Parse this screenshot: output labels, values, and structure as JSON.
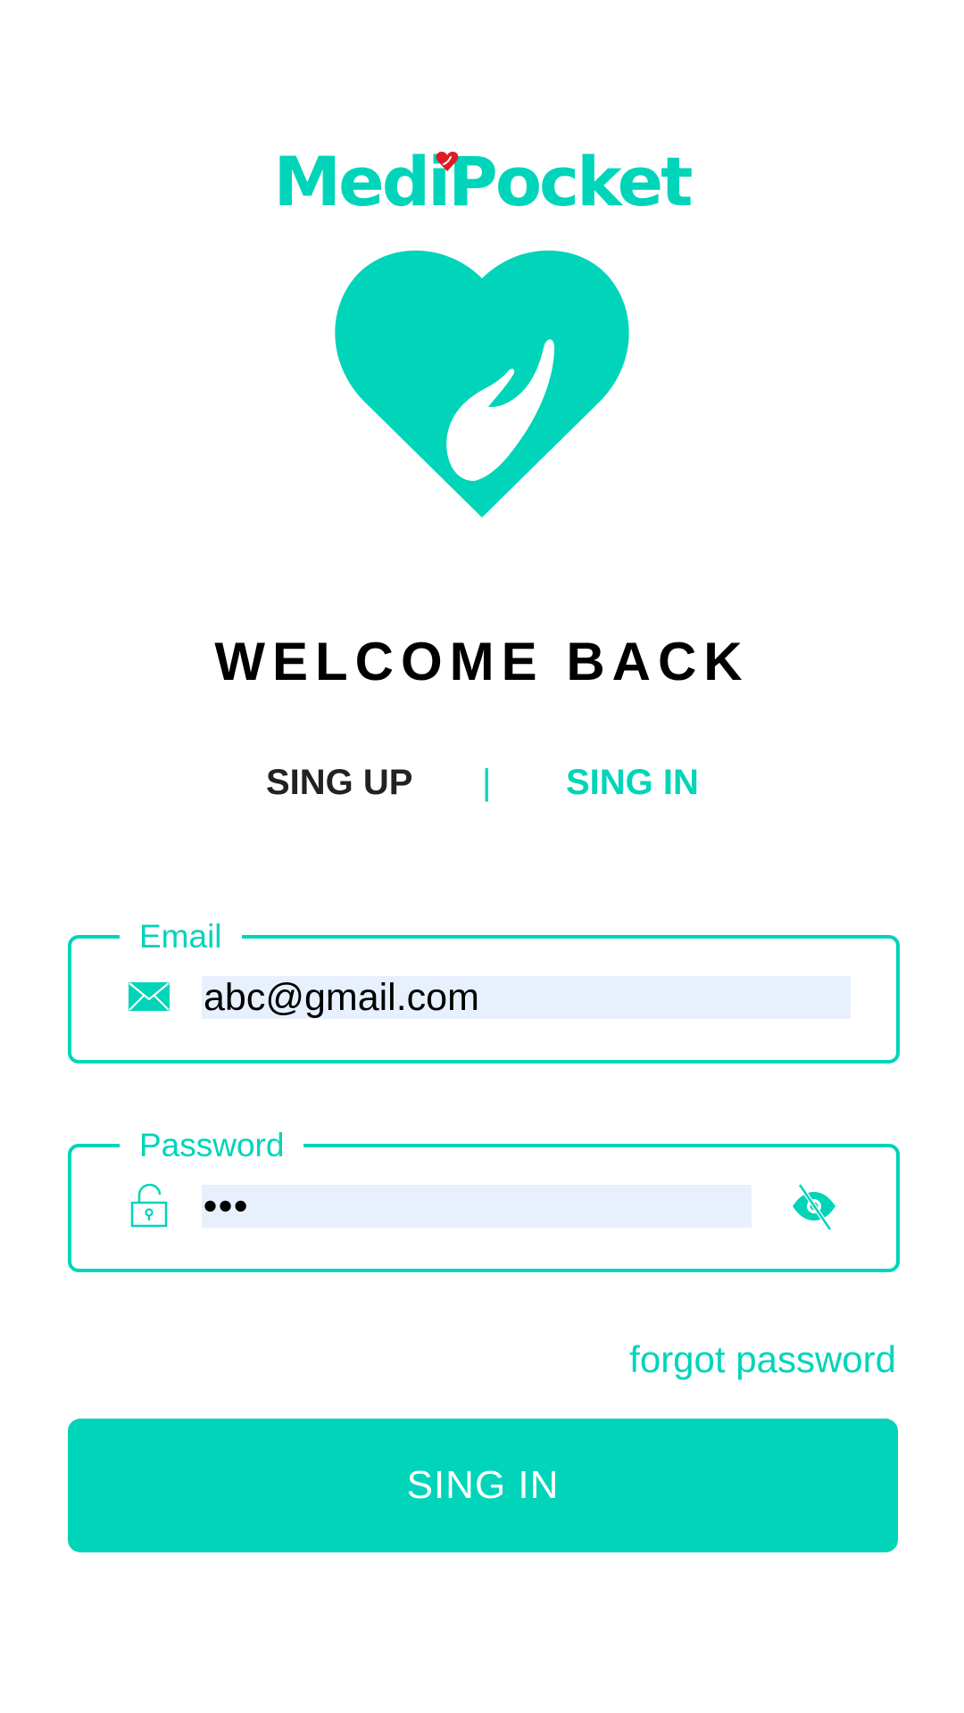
{
  "brand": {
    "name": "MediPocket",
    "accent_color": "#00d4b9",
    "heart_color": "#e01b24",
    "logo_icon": "heart-hand-icon"
  },
  "heading": "WELCOME BACK",
  "tabs": {
    "signup_label": "SING UP",
    "divider": "|",
    "signin_label": "SING IN",
    "active": "SING IN"
  },
  "email": {
    "label": "Email",
    "value": "abc@gmail.com",
    "icon": "envelope-icon"
  },
  "password": {
    "label": "Password",
    "value": "•••",
    "icon": "unlock-icon",
    "toggle_icon": "eye-off-icon"
  },
  "forgot_password": "forgot password",
  "submit": {
    "label": "SING IN"
  }
}
